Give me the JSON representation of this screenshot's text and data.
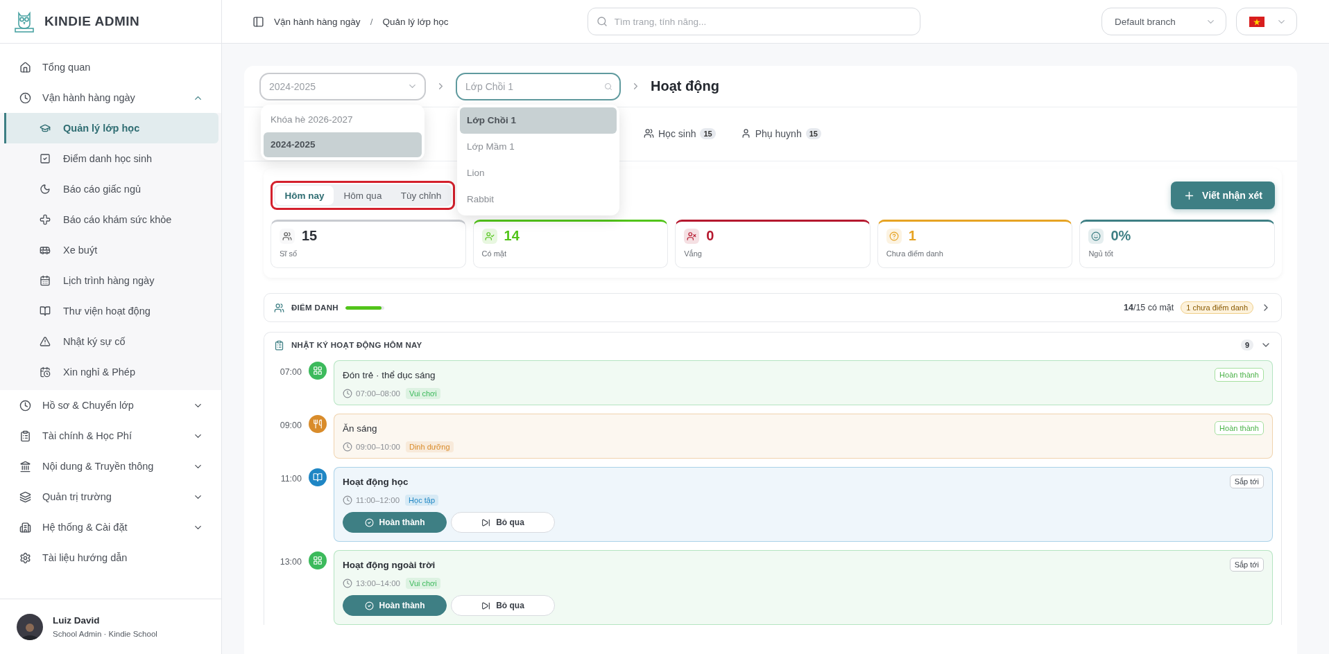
{
  "sidebar": {
    "brand": "KINDIE ADMIN",
    "items": [
      {
        "label": "Tổng quan",
        "selected": false
      },
      {
        "label": "Vận hành hàng ngày",
        "selected": false,
        "expanded": true,
        "children": [
          {
            "label": "Quản lý lớp học",
            "selected": true
          },
          {
            "label": "Điểm danh học sinh",
            "selected": false
          },
          {
            "label": "Báo cáo giấc ngủ",
            "selected": false
          },
          {
            "label": "Báo cáo khám sức khỏe",
            "selected": false
          },
          {
            "label": "Xe buýt",
            "selected": false
          },
          {
            "label": "Lịch trình hàng ngày",
            "selected": false
          },
          {
            "label": "Thư viện hoạt động",
            "selected": false
          },
          {
            "label": "Nhật ký sự cố",
            "selected": false
          },
          {
            "label": "Xin nghỉ & Phép",
            "selected": false
          }
        ]
      },
      {
        "label": "Hồ sơ & Chuyển lớp",
        "selected": false,
        "expanded": false
      },
      {
        "label": "Tài chính & Học Phí",
        "selected": false,
        "expanded": false
      },
      {
        "label": "Nội dung & Truyền thông",
        "selected": false,
        "expanded": false
      },
      {
        "label": "Quản trị trường",
        "selected": false,
        "expanded": false
      },
      {
        "label": "Hệ thống & Cài đặt",
        "selected": false,
        "expanded": false
      },
      {
        "label": "Tài liệu hướng dẫn",
        "selected": false
      }
    ],
    "user": {
      "name": "Luiz David",
      "role": "School Admin · Kindie School"
    }
  },
  "header": {
    "breadcrumb": [
      "Vận hành hàng ngày",
      "Quản lý lớp học"
    ],
    "breadcrumb_separator": "/",
    "search": {
      "placeholder": "Tìm trang, tính năng..."
    },
    "branch": "Default branch"
  },
  "selectors": {
    "year": {
      "placeholder": "2024-2025",
      "options": [
        {
          "label": "Khóa hè 2026-2027",
          "selected": false
        },
        {
          "label": "2024-2025",
          "selected": true
        }
      ]
    },
    "class": {
      "placeholder": "Lớp Chồi 1",
      "options": [
        {
          "label": "Lớp Chồi 1",
          "selected": true
        },
        {
          "label": "Lớp Mầm 1",
          "selected": false
        },
        {
          "label": "Lion",
          "selected": false
        },
        {
          "label": "Rabbit",
          "selected": false
        }
      ]
    },
    "page_title": "Hoạt động"
  },
  "tabs": [
    {
      "label": "Học sinh",
      "count": "15",
      "selected": false
    },
    {
      "label": "Phụ huynh",
      "count": "15",
      "selected": false
    }
  ],
  "day_filter": [
    {
      "label": "Hôm nay",
      "selected": true
    },
    {
      "label": "Hôm qua",
      "selected": false
    },
    {
      "label": "Tùy chỉnh",
      "selected": false
    }
  ],
  "write_button": "Viết nhận xét",
  "stats": [
    {
      "value": "15",
      "label": "Sĩ số",
      "color": "#c8cbd0"
    },
    {
      "value": "14",
      "label": "Có mặt",
      "color": "#52c41a"
    },
    {
      "value": "0",
      "label": "Vắng",
      "color": "#b5182e"
    },
    {
      "value": "1",
      "label": "Chưa điểm danh",
      "color": "#e6a323"
    },
    {
      "value": "0%",
      "label": "Ngủ tốt",
      "color": "#3e7f84"
    }
  ],
  "attendance": {
    "title": "ĐIỂM DANH",
    "level": 0.93,
    "present": "14",
    "total": "/15 có mặt",
    "pending": "1 chưa điểm danh"
  },
  "log": {
    "title": "NHẬT KÝ HOẠT ĐỘNG HÔM NAY",
    "count": "9",
    "entries": [
      {
        "time": "07:00",
        "kind": "play",
        "color": "#3cba5c",
        "title": "Đón trẻ · thể dục sáng",
        "duration": "07:00–08:00",
        "category": "Vui chơi",
        "completed": true,
        "status": "Hoàn thành"
      },
      {
        "time": "09:00",
        "kind": "meal",
        "color": "#d98c2b",
        "title": "Ăn sáng",
        "duration": "09:00–10:00",
        "category": "Dinh dưỡng",
        "completed": true,
        "status": "Hoàn thành"
      },
      {
        "time": "11:00",
        "kind": "study",
        "color": "#1f86c4",
        "title": "Hoạt động học",
        "duration": "11:00–12:00",
        "category": "Học tập",
        "completed": false,
        "status": "Sắp tới",
        "actions": [
          "Hoàn thành",
          "Bỏ qua"
        ]
      },
      {
        "time": "13:00",
        "kind": "play",
        "color": "#3cba5c",
        "title": "Hoạt động ngoài trời",
        "duration": "13:00–14:00",
        "category": "Vui chơi",
        "completed": false,
        "status": "Sắp tới",
        "actions": [
          "Hoàn thành",
          "Bỏ qua"
        ]
      }
    ]
  }
}
